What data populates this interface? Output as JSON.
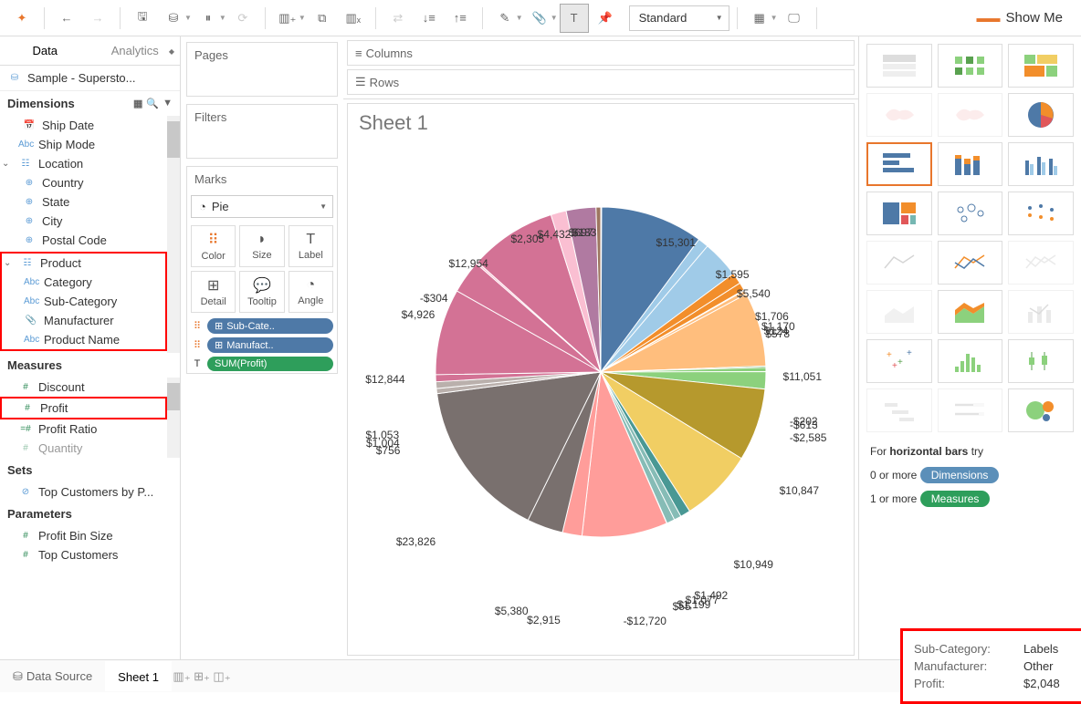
{
  "toolbar": {
    "standard": "Standard",
    "showme": "Show Me"
  },
  "sidebar": {
    "tabs": {
      "data": "Data",
      "analytics": "Analytics"
    },
    "datasource": "Sample - Supersto...",
    "sections": {
      "dimensions": "Dimensions",
      "measures": "Measures",
      "sets": "Sets",
      "parameters": "Parameters"
    },
    "dims": {
      "ship_date": "Ship Date",
      "ship_mode": "Ship Mode",
      "location": "Location",
      "country": "Country",
      "state": "State",
      "city": "City",
      "postal_code": "Postal Code",
      "product": "Product",
      "category": "Category",
      "sub_category": "Sub-Category",
      "manufacturer": "Manufacturer",
      "product_name": "Product Name"
    },
    "meas": {
      "discount": "Discount",
      "profit": "Profit",
      "profit_ratio": "Profit Ratio",
      "quantity": "Quantity"
    },
    "sets_list": {
      "top_customers": "Top Customers by P..."
    },
    "params": {
      "profit_bin": "Profit Bin Size",
      "top_customers": "Top Customers"
    }
  },
  "cards": {
    "pages": "Pages",
    "filters": "Filters",
    "marks": "Marks",
    "mark_type": "Pie",
    "cells": {
      "color": "Color",
      "size": "Size",
      "label": "Label",
      "detail": "Detail",
      "tooltip": "Tooltip",
      "angle": "Angle"
    },
    "pills": {
      "subcat": "Sub-Cate..",
      "manuf": "Manufact..",
      "profit": "SUM(Profit)"
    }
  },
  "shelves": {
    "columns": "Columns",
    "rows": "Rows"
  },
  "viz": {
    "title": "Sheet 1",
    "tooltip": {
      "k1": "Sub-Category:",
      "v1": "Labels",
      "k2": "Manufacturer:",
      "v2": "Other",
      "k3": "Profit:",
      "v3": "$2,048"
    }
  },
  "chart_data": {
    "type": "pie",
    "title": "Sheet 1",
    "slices": [
      {
        "label": "$133",
        "value": 133,
        "color": "#4e79a7"
      },
      {
        "label": "$15,301",
        "value": 15301,
        "color": "#4e79a7"
      },
      {
        "label": "$1,595",
        "value": 1595,
        "color": "#a0cbe8"
      },
      {
        "label": "$5,540",
        "value": 5540,
        "color": "#a0cbe8"
      },
      {
        "label": "$1,706",
        "value": 1706,
        "color": "#f28e2b"
      },
      {
        "label": "$1,170",
        "value": 1170,
        "color": "#f28e2b"
      },
      {
        "label": "$124",
        "value": 124,
        "color": "#ffbe7d"
      },
      {
        "label": "$578",
        "value": 578,
        "color": "#ffbe7d"
      },
      {
        "label": "$11,051",
        "value": 11051,
        "color": "#ffbe7d"
      },
      {
        "label": "-$202",
        "value": -202,
        "color": "#59a14f"
      },
      {
        "label": "-$613",
        "value": -613,
        "color": "#8cd17d"
      },
      {
        "label": "-$2,585",
        "value": -2585,
        "color": "#8cd17d"
      },
      {
        "label": "$10,847",
        "value": 10847,
        "color": "#b6992d"
      },
      {
        "label": "$10,949",
        "value": 10949,
        "color": "#f1ce63"
      },
      {
        "label": "$1,492",
        "value": 1492,
        "color": "#499894"
      },
      {
        "label": "$1,077",
        "value": 1077,
        "color": "#86bcb6"
      },
      {
        "label": "$1,199",
        "value": 1199,
        "color": "#86bcb6"
      },
      {
        "label": "$55",
        "value": 55,
        "color": "#e15759"
      },
      {
        "label": "-$12,720",
        "value": -12720,
        "color": "#ff9d9a"
      },
      {
        "label": "$2,915",
        "value": 2915,
        "color": "#ff9d9a"
      },
      {
        "label": "$5,380",
        "value": 5380,
        "color": "#79706e"
      },
      {
        "label": "$23,826",
        "value": 23826,
        "color": "#79706e"
      },
      {
        "label": "$756",
        "value": 756,
        "color": "#bab0ac"
      },
      {
        "label": "$1,004",
        "value": 1004,
        "color": "#bab0ac"
      },
      {
        "label": "$1,053",
        "value": 1053,
        "color": "#d37295"
      },
      {
        "label": "$12,844",
        "value": 12844,
        "color": "#d37295"
      },
      {
        "label": "$4,926",
        "value": 4926,
        "color": "#d37295"
      },
      {
        "label": "-$304",
        "value": -304,
        "color": "#fabfd2"
      },
      {
        "label": "$12,954",
        "value": 12954,
        "color": "#d37295"
      },
      {
        "label": "$2,305",
        "value": 2305,
        "color": "#fabfd2"
      },
      {
        "label": "-$4,432",
        "value": -4432,
        "color": "#b07aa1"
      },
      {
        "label": "$697",
        "value": 697,
        "color": "#9d7660"
      }
    ]
  },
  "showme": {
    "hint_for": "For ",
    "hint_type": "horizontal bars",
    "hint_try": " try",
    "req1_prefix": "0 or more ",
    "req1_pill": "Dimensions",
    "req2_prefix": "1 or more ",
    "req2_pill": "Measures"
  },
  "bottom": {
    "datasource": "Data Source",
    "sheet1": "Sheet 1"
  }
}
